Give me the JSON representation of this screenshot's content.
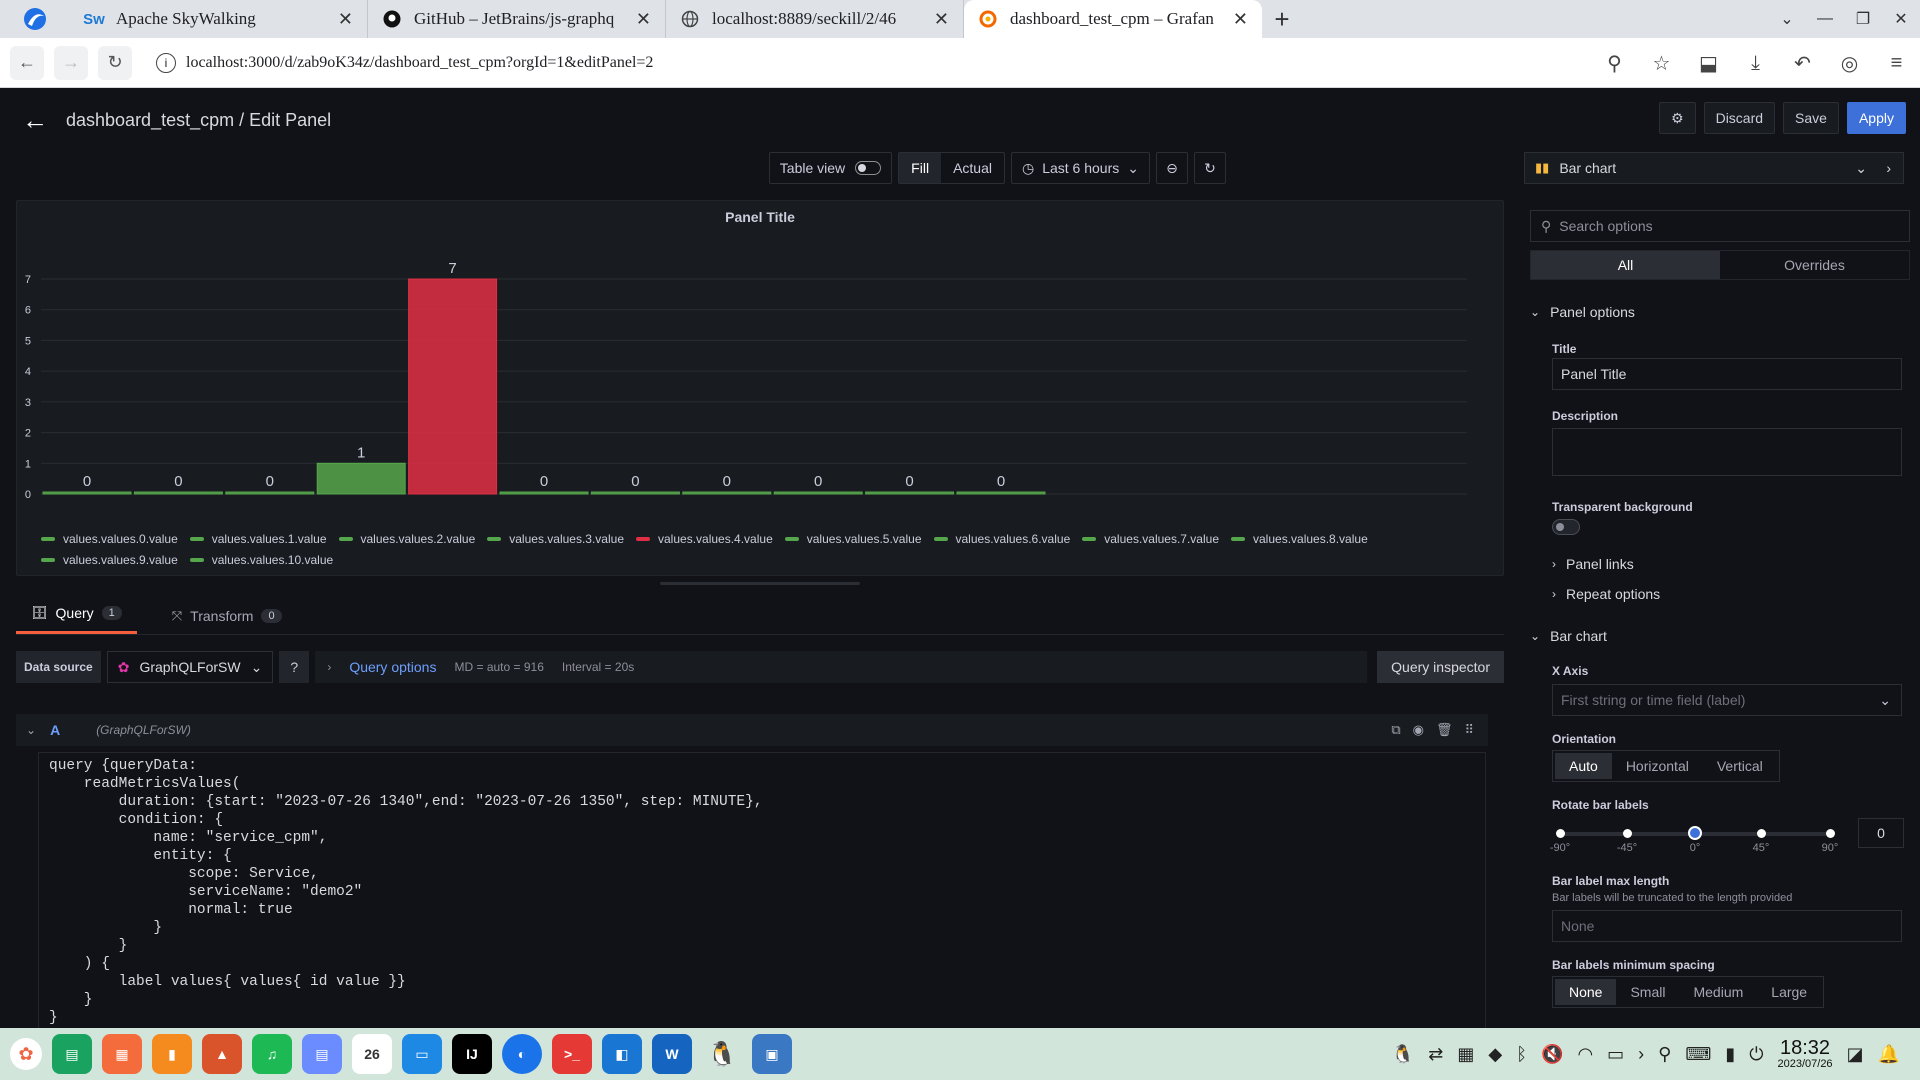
{
  "browser": {
    "tabs": [
      {
        "title": "Apache SkyWalking",
        "icon": "skywalking-icon"
      },
      {
        "title": "GitHub – JetBrains/js-graphq",
        "icon": "github-icon"
      },
      {
        "title": "localhost:8889/seckill/2/46",
        "icon": "globe-icon"
      },
      {
        "title": "dashboard_test_cpm – Grafan",
        "icon": "grafana-icon"
      }
    ],
    "url": "localhost:3000/d/zab9oK34z/dashboard_test_cpm?orgId=1&editPanel=2"
  },
  "header": {
    "title": "dashboard_test_cpm / Edit Panel",
    "discard": "Discard",
    "save": "Save",
    "apply": "Apply"
  },
  "toolbar": {
    "table_view": "Table view",
    "fill": "Fill",
    "actual": "Actual",
    "time_range": "Last 6 hours"
  },
  "panel": {
    "title": "Panel Title"
  },
  "chart_data": {
    "type": "bar",
    "title": "Panel Title",
    "categories": [
      "values.values.0.value",
      "values.values.1.value",
      "values.values.2.value",
      "values.values.3.value",
      "values.values.4.value",
      "values.values.5.value",
      "values.values.6.value",
      "values.values.7.value",
      "values.values.8.value",
      "values.values.9.value",
      "values.values.10.value"
    ],
    "values": [
      0,
      0,
      0,
      1,
      7,
      0,
      0,
      0,
      0,
      0,
      0
    ],
    "colors": [
      "#56a64b",
      "#56a64b",
      "#56a64b",
      "#56a64b",
      "#e02f44",
      "#56a64b",
      "#56a64b",
      "#56a64b",
      "#56a64b",
      "#56a64b",
      "#56a64b"
    ],
    "ylim": [
      0,
      7
    ],
    "yticks": [
      0,
      1,
      2,
      3,
      4,
      5,
      6,
      7
    ],
    "grid": true,
    "legend": "bottom"
  },
  "query_tabs": {
    "query_label": "Query",
    "query_count": "1",
    "transform_label": "Transform",
    "transform_count": "0"
  },
  "datasource": {
    "label": "Data source",
    "name": "GraphQLForSW",
    "query_options": "Query options",
    "md": "MD = auto = 916",
    "interval": "Interval = 20s",
    "inspector": "Query inspector"
  },
  "query_row": {
    "ref": "A",
    "ds": "(GraphQLForSW)"
  },
  "query_text": "query {queryData:\n    readMetricsValues(\n        duration: {start: \"2023-07-26 1340\",end: \"2023-07-26 1350\", step: MINUTE},\n        condition: {\n            name: \"service_cpm\",\n            entity: {\n                scope: Service,\n                serviceName: \"demo2\"\n                normal: true\n            }\n        }\n    ) {\n        label values{ values{ id value }}\n    }\n}",
  "options": {
    "viz": "Bar chart",
    "search_placeholder": "Search options",
    "tab_all": "All",
    "tab_overrides": "Overrides",
    "panel_options": "Panel options",
    "title_label": "Title",
    "title_value": "Panel Title",
    "description_label": "Description",
    "transparent_label": "Transparent background",
    "panel_links": "Panel links",
    "repeat_options": "Repeat options",
    "bar_chart_section": "Bar chart",
    "x_axis_label": "X Axis",
    "x_axis_placeholder": "First string or time field (label)",
    "orientation_label": "Orientation",
    "orientation_options": [
      "Auto",
      "Horizontal",
      "Vertical"
    ],
    "rotate_label": "Rotate bar labels",
    "rotate_ticks": [
      "-90°",
      "-45°",
      "0°",
      "45°",
      "90°"
    ],
    "rotate_value": "0",
    "max_length_label": "Bar label max length",
    "max_length_desc": "Bar labels will be truncated to the length provided",
    "max_length_placeholder": "None",
    "min_spacing_label": "Bar labels minimum spacing",
    "min_spacing_options": [
      "None",
      "Small",
      "Medium",
      "Large"
    ]
  },
  "taskbar": {
    "time": "18:32",
    "date": "2023/07/26"
  }
}
